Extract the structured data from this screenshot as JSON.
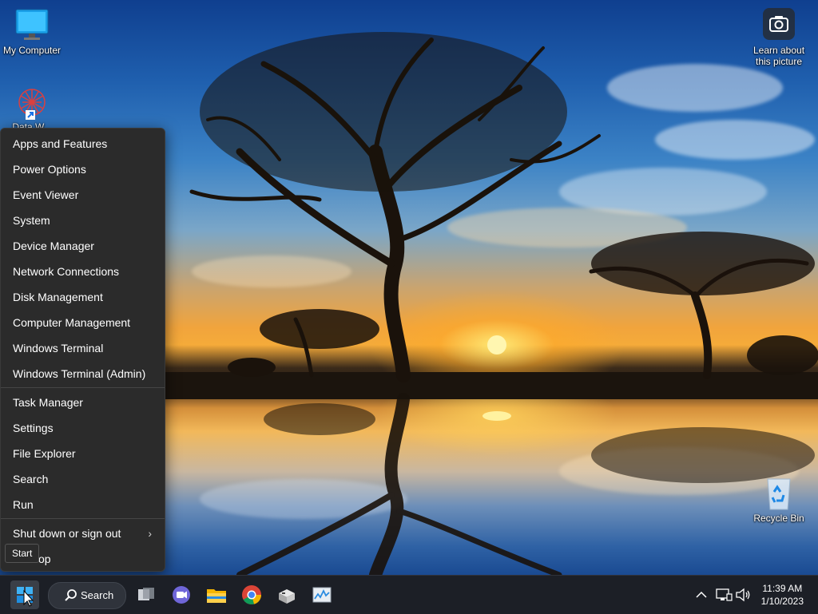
{
  "desktop": {
    "icons": [
      {
        "label": "My Computer"
      },
      {
        "label": "Data W..."
      },
      {
        "label": "Learn about this picture"
      },
      {
        "label": "Recycle Bin"
      }
    ]
  },
  "context_menu": {
    "items": [
      "Apps and Features",
      "Power Options",
      "Event Viewer",
      "System",
      "Device Manager",
      "Network Connections",
      "Disk Management",
      "Computer Management",
      "Windows Terminal",
      "Windows Terminal (Admin)",
      "Task Manager",
      "Settings",
      "File Explorer",
      "Search",
      "Run",
      "Shut down or sign out",
      "op"
    ]
  },
  "tooltip": {
    "text": "Start"
  },
  "taskbar": {
    "search_label": "Search",
    "time": "11:39 AM",
    "date": "1/10/2023",
    "icons": [
      "windows-start-icon",
      "search-icon",
      "task-view-icon",
      "chat-icon",
      "file-explorer-icon",
      "chrome-icon",
      "app-icon",
      "task-manager-icon"
    ]
  },
  "colors": {
    "menu_bg": "#2b2b2b",
    "taskbar_bg": "#1c1f26",
    "accent": "#0078d4"
  }
}
